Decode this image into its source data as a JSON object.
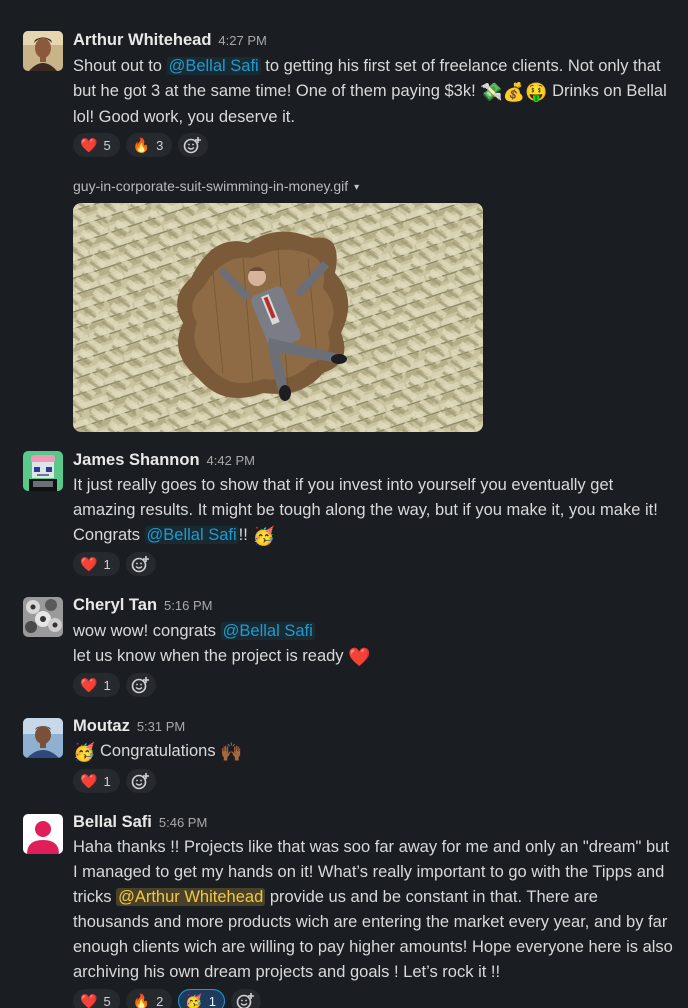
{
  "messages": [
    {
      "author": "Arthur Whitehead",
      "time": "4:27 PM",
      "text_1": "Shout out to ",
      "mention": "@Bellal Safi",
      "text_2": " to getting his first set of freelance clients. Not only that but he got 3 at the same time! One of them paying $3k! ",
      "emojis": [
        "💸",
        "💰",
        "🤑"
      ],
      "text_3": " Drinks on Bellal lol! Good work, you deserve it.",
      "attachment": {
        "filename": "guy-in-corporate-suit-swimming-in-money.gif",
        "caret": "▾"
      },
      "reactions": [
        {
          "emoji": "❤️",
          "icon": "heart-icon",
          "count": "5"
        },
        {
          "emoji": "🔥",
          "icon": "fire-icon",
          "count": "3"
        }
      ]
    },
    {
      "author": "James Shannon",
      "time": "4:42 PM",
      "text_1": "It just really goes to show that if you invest into yourself you eventually get amazing results. It might be tough along the way, but if you make it, you make it! Congrats ",
      "mention": "@Bellal Safi",
      "text_2": "!! ",
      "emoji": "🥳",
      "reactions": [
        {
          "emoji": "❤️",
          "icon": "heart-icon",
          "count": "1"
        }
      ]
    },
    {
      "author": "Cheryl Tan",
      "time": "5:16 PM",
      "text_1": "wow wow! congrats ",
      "mention": "@Bellal Safi",
      "line_2": "let us know when the project is ready ",
      "emoji": "❤️",
      "reactions": [
        {
          "emoji": "❤️",
          "icon": "heart-icon",
          "count": "1"
        }
      ]
    },
    {
      "author": "Moutaz",
      "time": "5:31 PM",
      "emoji_1": "🥳",
      "text_1": " Congratulations ",
      "emoji_2": "🙌🏾",
      "reactions": [
        {
          "emoji": "❤️",
          "icon": "heart-icon",
          "count": "1"
        }
      ]
    },
    {
      "author": "Bellal Safi",
      "time": "5:46 PM",
      "text_1": "Haha thanks !! Projects like that was soo far away for me and only an \"dream\" but I managed  to get my hands on it! What’s really important to go with the Tipps and tricks ",
      "mention": "@Arthur Whitehead",
      "text_2": " provide us and be constant in that. There are thousands and more products wich are entering the market every year, and by far enough clients wich are willing to pay higher amounts! Hope everyone here is also archiving his own dream projects and goals ! Let’s rock it !!",
      "reactions": [
        {
          "emoji": "❤️",
          "icon": "heart-icon",
          "count": "5"
        },
        {
          "emoji": "🔥",
          "icon": "fire-icon",
          "count": "2"
        },
        {
          "emoji": "🥳",
          "icon": "party-face-icon",
          "count": "1",
          "active": true
        }
      ]
    }
  ],
  "colors": {
    "background": "#1a1d21",
    "mention": "#1d9bd1",
    "highlight_mention": "#f2c744",
    "pill": "#26292e"
  }
}
